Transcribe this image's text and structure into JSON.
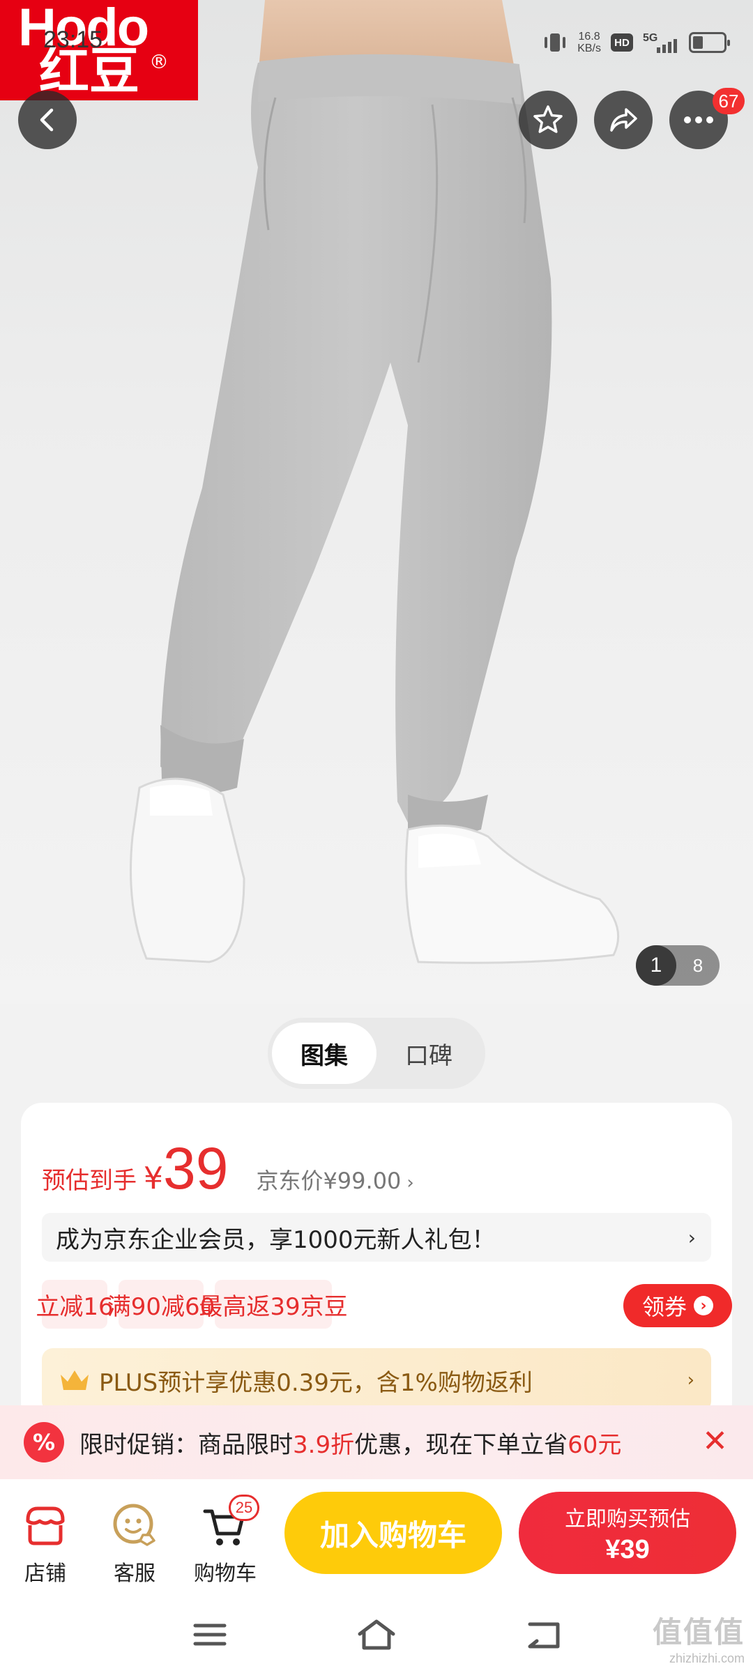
{
  "status_bar": {
    "time": "23:15",
    "speed_value": "16.8",
    "speed_unit": "KB/s",
    "hd_label": "HD",
    "network": "5G"
  },
  "brand": {
    "logo_en": "Hodo",
    "logo_zh": "红豆",
    "logo_reg": "®"
  },
  "top_actions": {
    "more_badge": "67"
  },
  "gallery": {
    "current_page": "1",
    "total_pages": "8"
  },
  "tabs": [
    {
      "label": "图集",
      "active": true
    },
    {
      "label": "口碑",
      "active": false
    }
  ],
  "price": {
    "est_label": "预估到手",
    "currency": "¥",
    "est_value": "39",
    "jd_price_label": "京东价¥99.00",
    "jd_chevron": "›"
  },
  "member_banner": {
    "text": "成为京东企业会员，享1000元新人礼包！",
    "arrow": "›"
  },
  "tags": [
    "立减16",
    "满90减60",
    "最高返39京豆"
  ],
  "coupon_button": {
    "label": "领券",
    "arrow": "›"
  },
  "plus_banner": {
    "text": "PLUS预计享优惠0.39元，含1%购物返利",
    "arrow": "›"
  },
  "promo": {
    "icon_text": "%",
    "prefix": "限时促销：商品限时",
    "discount": "3.9折",
    "middle": "优惠，现在下单立省",
    "saving": "60元",
    "close": "✕"
  },
  "bottom_bar": {
    "shop_label": "店铺",
    "service_label": "客服",
    "cart_label": "购物车",
    "cart_badge": "25",
    "add_to_cart": "加入购物车",
    "buy_now_line1": "立即购买预估",
    "buy_now_line2": "¥39"
  },
  "watermark": {
    "line1": "值值值",
    "line2": "zhizhizhi.com"
  },
  "colors": {
    "brand_red": "#e60012",
    "price_red": "#e62e2e",
    "cart_yellow": "#fecb0a",
    "buy_red": "#f02b3d",
    "plus_gold": "#8a5a13"
  }
}
